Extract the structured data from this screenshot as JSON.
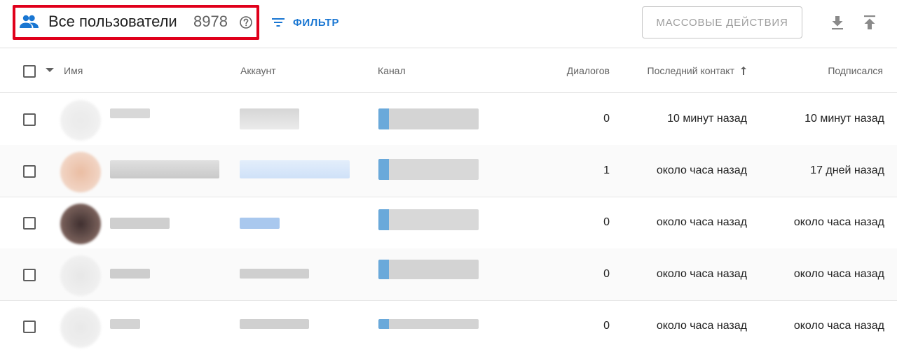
{
  "header": {
    "title": "Все пользователи",
    "count": "8978",
    "filter_label": "ФИЛЬТР",
    "bulk_actions_label": "МАССОВЫЕ ДЕЙСТВИЯ",
    "icons": [
      "people-icon",
      "help-icon",
      "filter-icon",
      "download-icon",
      "upload-icon"
    ],
    "accent_color": "#1976d2",
    "highlight_color": "#e0001b"
  },
  "table": {
    "columns": {
      "name": "Имя",
      "account": "Аккаунт",
      "channel": "Канал",
      "dialogs": "Диалогов",
      "last_contact": "Последний контакт",
      "subscribed": "Подписался"
    },
    "sort": {
      "column": "last_contact",
      "direction": "up"
    },
    "rows": [
      {
        "dialogs": "0",
        "last_contact": "10 минут назад",
        "subscribed": "10 минут назад"
      },
      {
        "dialogs": "1",
        "last_contact": "около часа назад",
        "subscribed": "17 дней назад"
      },
      {
        "dialogs": "0",
        "last_contact": "около часа назад",
        "subscribed": "около часа назад"
      },
      {
        "dialogs": "0",
        "last_contact": "около часа назад",
        "subscribed": "около часа назад"
      },
      {
        "dialogs": "0",
        "last_contact": "около часа назад",
        "subscribed": "около часа назад"
      }
    ]
  }
}
